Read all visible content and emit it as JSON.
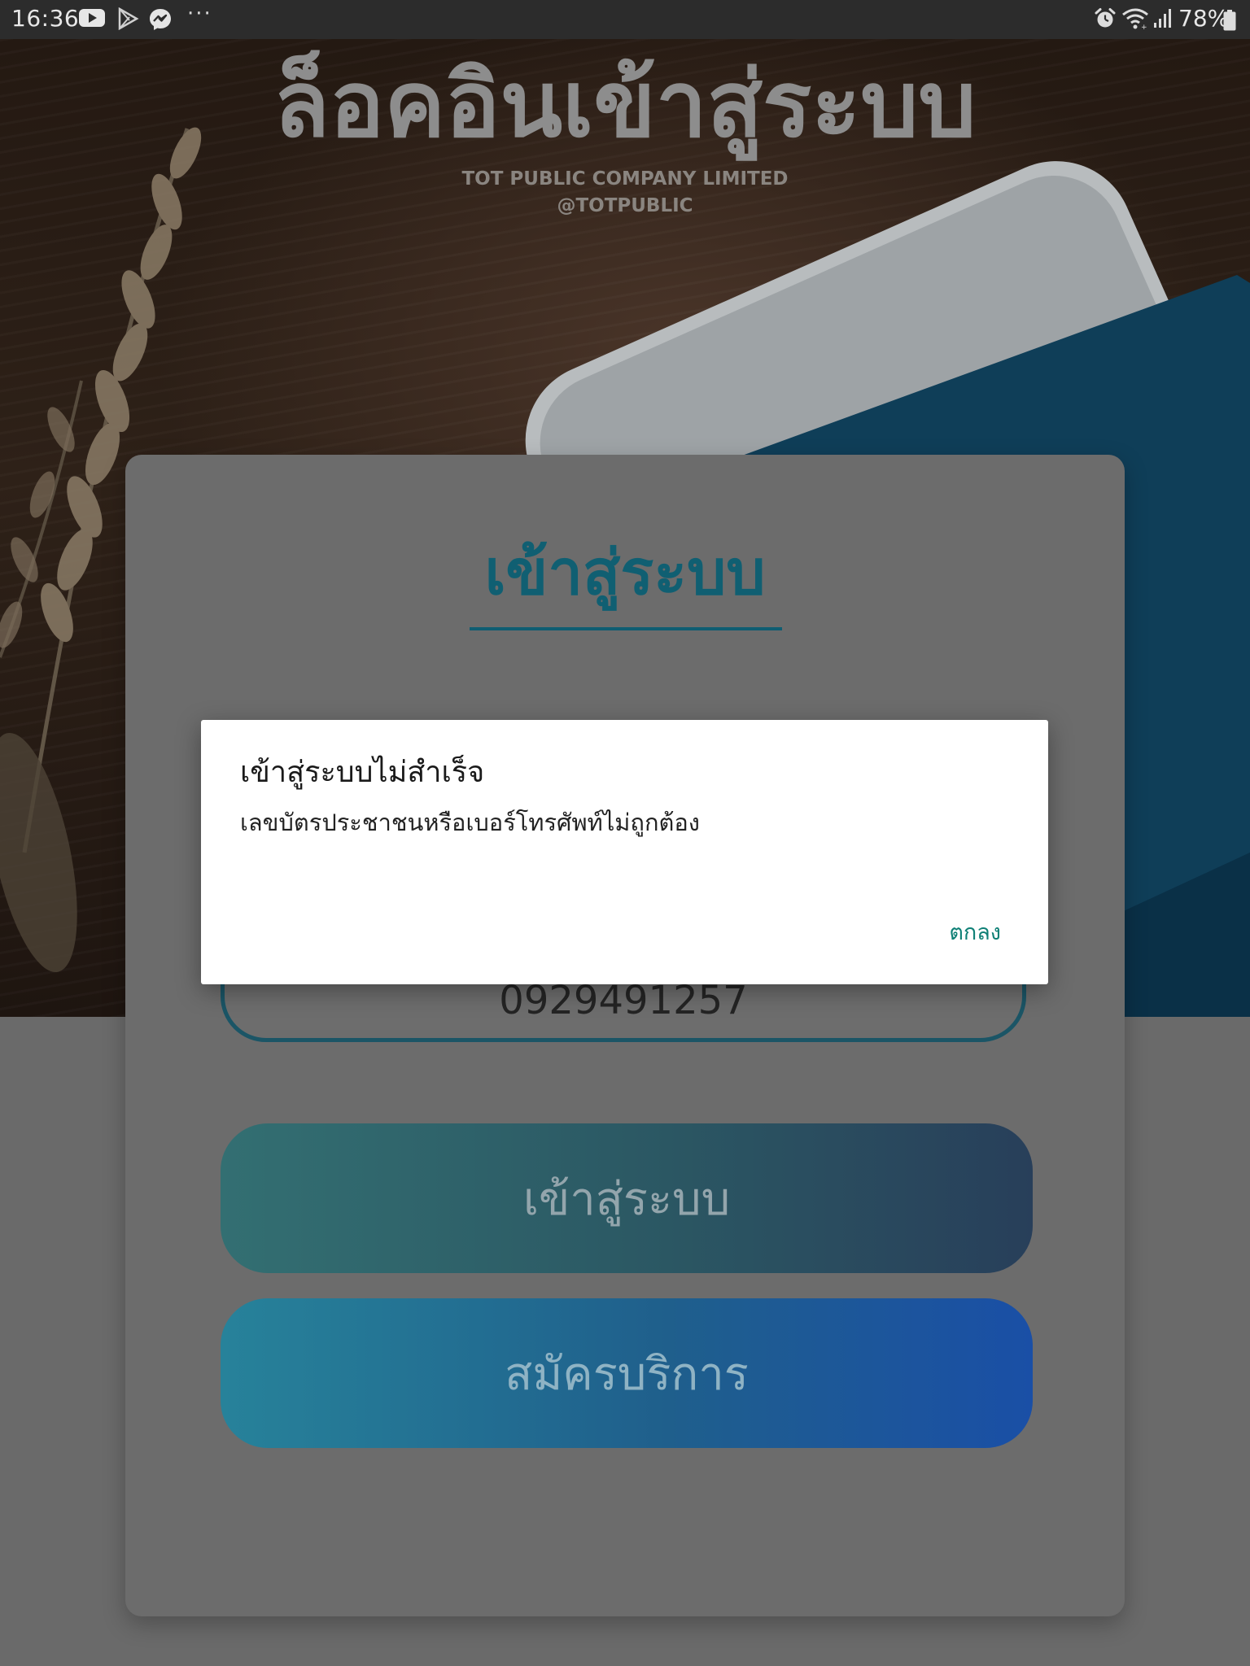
{
  "status_bar": {
    "time": "16:36",
    "more": "···",
    "battery": "78%",
    "icons": [
      "youtube-icon",
      "play-store-icon",
      "messenger-icon",
      "alarm-icon",
      "wifi-icon",
      "signal-icon",
      "battery-icon"
    ]
  },
  "hero": {
    "title": "ล็อคอินเข้าสู่ระบบ",
    "company": "TOT PUBLIC COMPANY LIMITED",
    "handle": "@TOTPUBLIC"
  },
  "card": {
    "title": "เข้าสู่ระบบ",
    "input_value": "0929491257",
    "login_button": "เข้าสู่ระบบ",
    "register_button": "สมัครบริการ"
  },
  "dialog": {
    "title": "เข้าสู่ระบบไม่สำเร็จ",
    "message": "เลขบัตรประชาชนหรือเบอร์โทรศัพท์ไม่ถูกต้อง",
    "ok_button": "ตกลง"
  },
  "colors": {
    "accent": "#0f8076",
    "card_title": "#105f72",
    "overlay": "#6a6a6a"
  }
}
